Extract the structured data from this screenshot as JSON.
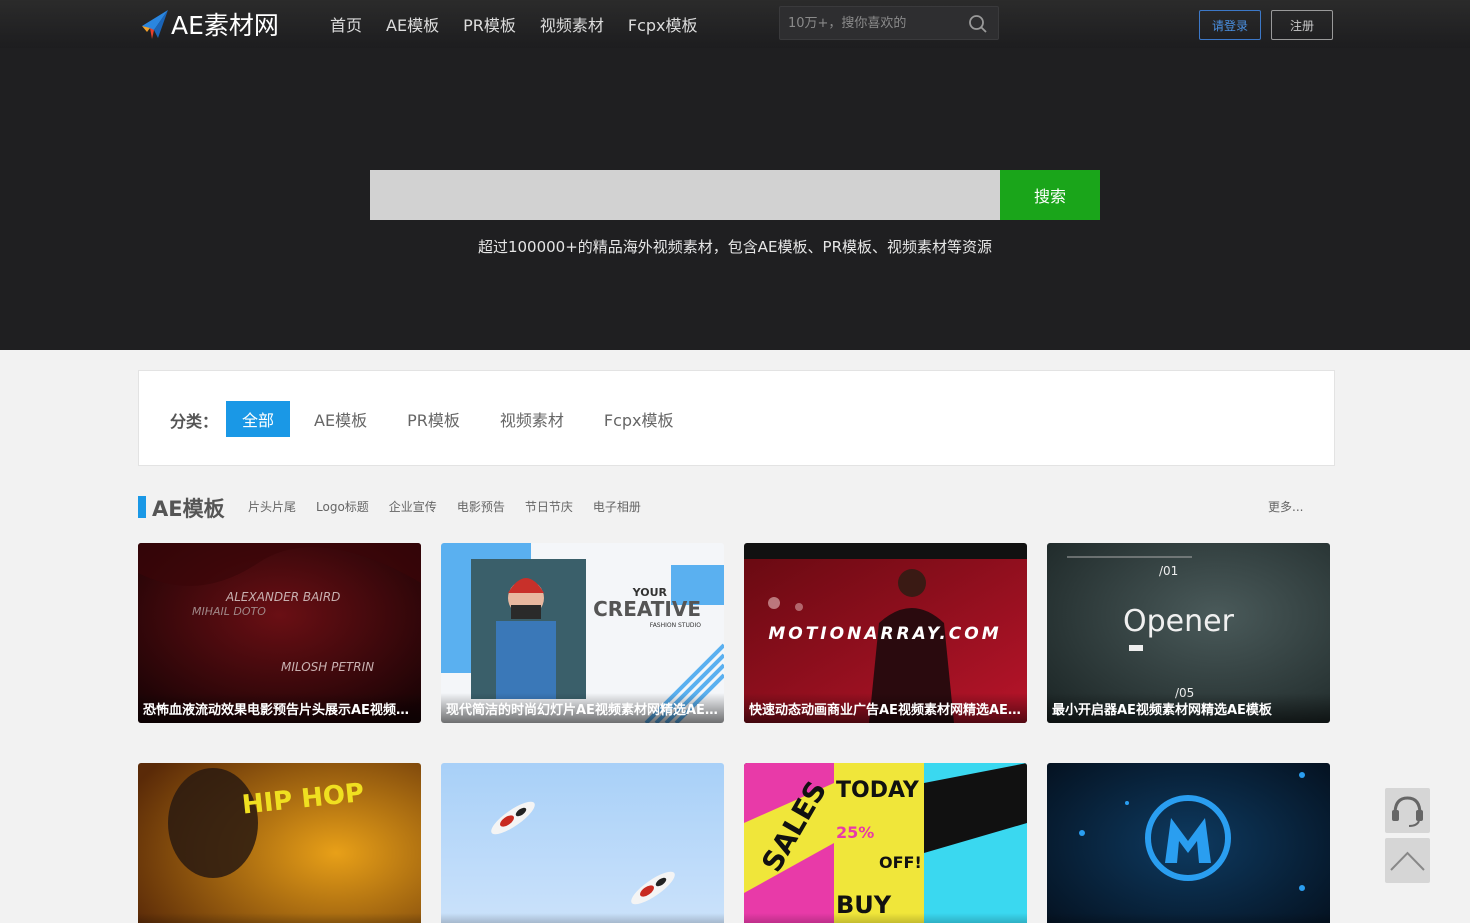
{
  "header": {
    "logo_text": "AE素材网",
    "nav": [
      "首页",
      "AE模板",
      "PR模板",
      "视频素材",
      "Fcpx模板"
    ],
    "search_placeholder": "10万+，搜你喜欢的",
    "login_label": "请登录",
    "register_label": "注册"
  },
  "hero": {
    "search_button": "搜索",
    "search_value": "",
    "subtitle": "超过100000+的精品海外视频素材，包含AE模板、PR模板、视频素材等资源"
  },
  "filter": {
    "label": "分类：",
    "items": [
      "全部",
      "AE模板",
      "PR模板",
      "视频素材",
      "Fcpx模板"
    ],
    "active": "全部"
  },
  "section": {
    "title": "AE模板",
    "tags": [
      "片头片尾",
      "Logo标题",
      "企业宣传",
      "电影预告",
      "节日节庆",
      "电子相册"
    ],
    "more": "更多..."
  },
  "cards": [
    {
      "caption": "恐怖血液流动效果电影预告片头展示AE视频素材网精选AE模板",
      "overlay": [
        "ALEXANDER BAIRD",
        "MIHAIL DOTO",
        "MILOSH PETRIN"
      ]
    },
    {
      "caption": "现代简洁的时尚幻灯片AE视频素材网精选AE模板",
      "overlay": [
        "YOUR",
        "CREATIVE",
        "FASHION STUDIO"
      ]
    },
    {
      "caption": "快速动态动画商业广告AE视频素材网精选AE模板",
      "overlay": [
        "MOTIONARRAY.COM"
      ]
    },
    {
      "caption": "最小开启器AE视频素材网精选AE模板",
      "overlay": [
        "/01",
        "Opener",
        "/05"
      ]
    },
    {
      "caption": "",
      "overlay": [
        "HIP HOP"
      ]
    },
    {
      "caption": "",
      "overlay": []
    },
    {
      "caption": "",
      "overlay": [
        "SALES",
        "TODAY",
        "OFF!",
        "BUY",
        "25%"
      ]
    },
    {
      "caption": "",
      "overlay": []
    }
  ],
  "colors": {
    "accent": "#1a98e6",
    "search_green": "#1aa51a",
    "hero_bg": "#1f1f21"
  },
  "icons": {
    "logo": "paper-plane-icon",
    "top_search": "search-icon",
    "support": "headset-icon",
    "back_to_top": "chevron-up-icon"
  }
}
